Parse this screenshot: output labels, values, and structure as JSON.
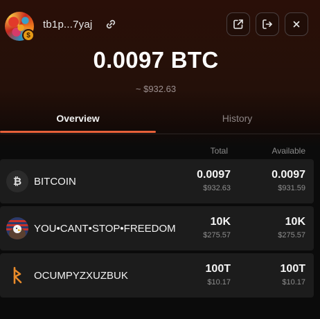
{
  "header": {
    "address": "tb1p...7yaj",
    "avatar_badge": "$",
    "icons": [
      "link-icon",
      "external-link-icon",
      "logout-icon",
      "close-icon"
    ]
  },
  "balance": {
    "amount": "0.0097 BTC",
    "fiat": "~ $932.63"
  },
  "tabs": [
    {
      "label": "Overview",
      "active": true
    },
    {
      "label": "History",
      "active": false
    }
  ],
  "columns": {
    "total": "Total",
    "available": "Available"
  },
  "assets": [
    {
      "name": "BITCOIN",
      "icon": "bitcoin-icon",
      "icon_glyph": "₿",
      "total": "0.0097",
      "total_fiat": "$932.63",
      "available": "0.0097",
      "available_fiat": "$931.59"
    },
    {
      "name": "YOU•CANT•STOP•FREEDOM",
      "icon": "eagle-flag-icon",
      "total": "10K",
      "total_fiat": "$275.57",
      "available": "10K",
      "available_fiat": "$275.57"
    },
    {
      "name": "OCUMPYZXUZBUK",
      "icon": "rune-icon",
      "total": "100T",
      "total_fiat": "$10.17",
      "available": "100T",
      "available_fiat": "$10.17"
    }
  ],
  "colors": {
    "accent": "#e8613a",
    "row_bg": "#1c1c1c",
    "page_bg": "#0b0b0b"
  }
}
